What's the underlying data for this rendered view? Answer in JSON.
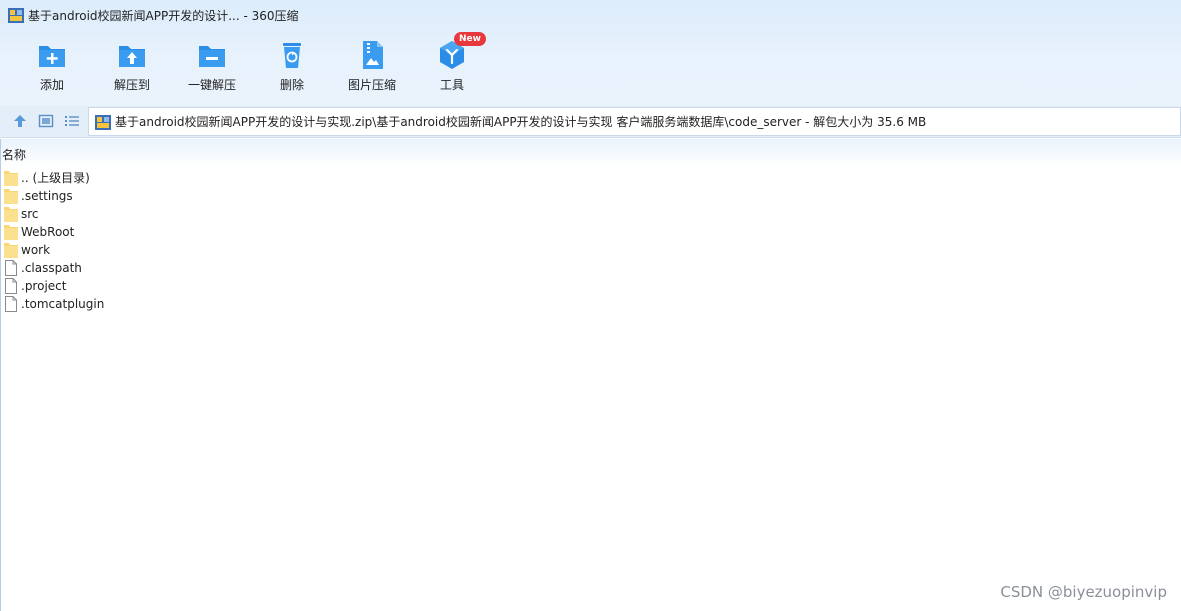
{
  "window": {
    "title": "基于android校园新闻APP开发的设计... - 360压缩"
  },
  "toolbar": {
    "items": [
      {
        "label": "添加",
        "icon": "add-icon"
      },
      {
        "label": "解压到",
        "icon": "extract-to-icon"
      },
      {
        "label": "一键解压",
        "icon": "one-click-extract-icon"
      },
      {
        "label": "删除",
        "icon": "delete-icon"
      },
      {
        "label": "图片压缩",
        "icon": "image-compress-icon"
      },
      {
        "label": "工具",
        "icon": "tools-icon",
        "badge": "New"
      }
    ]
  },
  "nav": {
    "address": "基于android校园新闻APP开发的设计与实现.zip\\基于android校园新闻APP开发的设计与实现 客户端服务端数据库\\code_server - 解包大小为 35.6 MB"
  },
  "list": {
    "column_name": "名称",
    "items": [
      {
        "name": ".. (上级目录)",
        "type": "folder"
      },
      {
        "name": ".settings",
        "type": "folder"
      },
      {
        "name": "src",
        "type": "folder"
      },
      {
        "name": "WebRoot",
        "type": "folder"
      },
      {
        "name": "work",
        "type": "folder"
      },
      {
        "name": ".classpath",
        "type": "file"
      },
      {
        "name": ".project",
        "type": "file"
      },
      {
        "name": ".tomcatplugin",
        "type": "file"
      }
    ]
  },
  "watermark": "CSDN @biyezuopinvip",
  "colors": {
    "accent": "#2b8de8",
    "folder": "#f9d777",
    "badge": "#e8383d"
  }
}
